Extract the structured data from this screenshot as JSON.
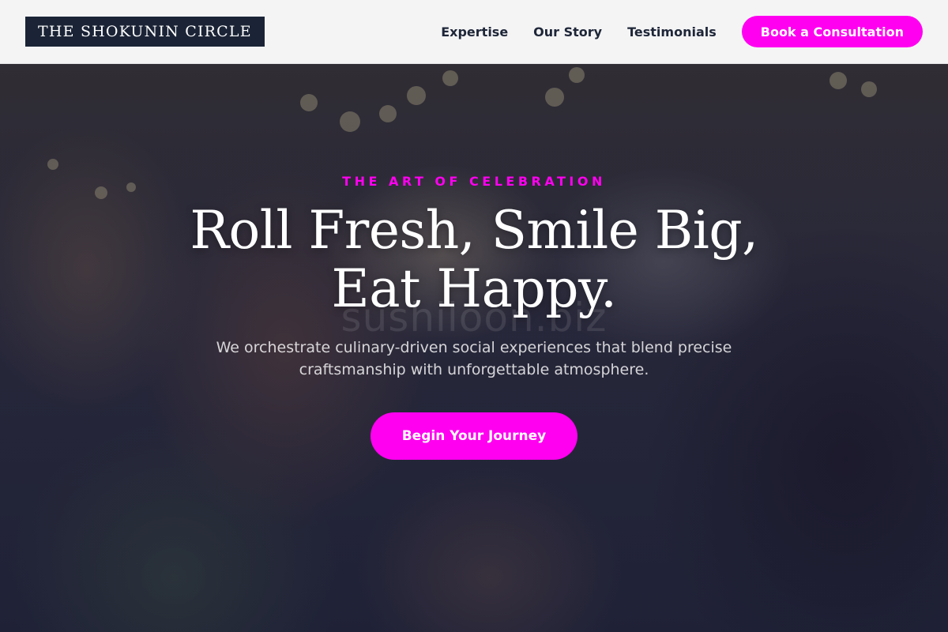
{
  "header": {
    "logo": "THE SHOKUNIN CIRCLE",
    "nav": [
      {
        "label": "Expertise"
      },
      {
        "label": "Our Story"
      },
      {
        "label": "Testimonials"
      }
    ],
    "cta_label": "Book a Consultation"
  },
  "hero": {
    "eyebrow": "THE ART OF CELEBRATION",
    "title": "Roll Fresh, Smile Big, Eat Happy.",
    "watermark": "sushiloon.biz",
    "subtitle": "We orchestrate culinary-driven social experiences that blend precise craftsmanship with unforgettable atmosphere.",
    "cta_label": "Begin Your Journey"
  },
  "colors": {
    "accent": "#ff00f0",
    "logo_background": "#1b2436",
    "header_background": "#f4f4f5",
    "nav_text": "#1e2638"
  }
}
